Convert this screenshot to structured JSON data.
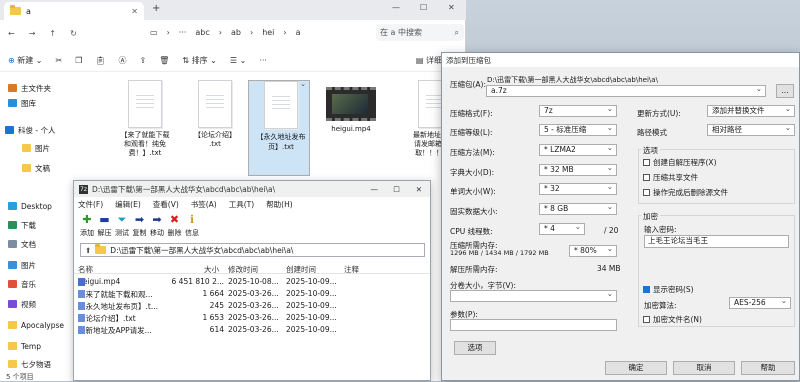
{
  "explorer": {
    "tab_title": "a",
    "address": [
      "abc",
      "ab",
      "hei",
      "a"
    ],
    "search_placeholder": "在 a 中搜索",
    "toolbar": {
      "new_label": "新建",
      "sort_label": "排序",
      "details_label": "详细信息"
    },
    "sidebar": [
      {
        "label": "主文件夹",
        "icon": "home-icon"
      },
      {
        "label": "图库",
        "icon": "gallery-icon"
      },
      {
        "label": "科俊 - 个人",
        "icon": "cloud-icon"
      },
      {
        "label": "图片",
        "icon": "folder-icon"
      },
      {
        "label": "文稿",
        "icon": "folder-icon"
      },
      {
        "label": "Desktop",
        "icon": "desktop-icon"
      },
      {
        "label": "下载",
        "icon": "download-icon"
      },
      {
        "label": "文档",
        "icon": "document-icon"
      },
      {
        "label": "图片",
        "icon": "pictures-icon"
      },
      {
        "label": "音乐",
        "icon": "music-icon"
      },
      {
        "label": "视频",
        "icon": "video-icon"
      },
      {
        "label": "Apocalypse",
        "icon": "folder-icon"
      },
      {
        "label": "Temp",
        "icon": "folder-icon"
      },
      {
        "label": "七夕物语",
        "icon": "folder-icon"
      }
    ],
    "files": [
      {
        "name": "【来了就能下载和观看！纯免费！】.txt",
        "line1": "【来了就能下载",
        "line2": "和观看！纯免",
        "line3": "费！】.txt"
      },
      {
        "name": "【论坛介绍】.txt",
        "line1": "【论坛介绍】",
        "line2": ".txt",
        "line3": ""
      },
      {
        "name": "【永久地址发布页】.txt",
        "line1": "【永久地址发布",
        "line2": "页】.txt",
        "line3": ""
      },
      {
        "name": "heigui.mp4",
        "line1": "heigui.mp4",
        "line2": "",
        "line3": ""
      },
      {
        "name": "最新地址及APP请发邮箱自动获取！！！.txt",
        "line1": "最新地址及AP",
        "line2": "请发邮箱自动",
        "line3": "取！！！.txt"
      }
    ],
    "status": "5 个项目"
  },
  "filemanager": {
    "title": "D:\\迅雷下载\\第一部黑人大战华女\\abcd\\abc\\ab\\hei\\a\\",
    "menu": [
      "文件(F)",
      "编辑(E)",
      "查看(V)",
      "书签(A)",
      "工具(T)",
      "帮助(H)"
    ],
    "tools": [
      "添加",
      "解压",
      "测试",
      "复制",
      "移动",
      "删除",
      "信息"
    ],
    "path": "D:\\迅雷下载\\第一部黑人大战华女\\abcd\\abc\\ab\\hei\\a\\",
    "columns": [
      "名称",
      "大小",
      "修改时间",
      "创建时间",
      "注释"
    ],
    "rows": [
      {
        "name": "heigui.mp4",
        "size": "6 451 810 2...",
        "modified": "2025-10-08...",
        "created": "2025-10-09..."
      },
      {
        "name": "【来了就能下载和观...",
        "size": "1 664",
        "modified": "2025-03-26...",
        "created": "2025-10-09..."
      },
      {
        "name": "【永久地址发布页】.t...",
        "size": "245",
        "modified": "2025-03-26...",
        "created": "2025-10-09..."
      },
      {
        "name": "【论坛介绍】.txt",
        "size": "1 653",
        "modified": "2025-03-26...",
        "created": "2025-10-09..."
      },
      {
        "name": "最新地址及APP请发...",
        "size": "614",
        "modified": "2025-03-26...",
        "created": "2025-10-09..."
      }
    ]
  },
  "dialog": {
    "title": "添加到压缩包",
    "archive_label": "压缩包(A):",
    "archive_path": "D:\\迅雷下载\\第一部黑人大战华女\\abcd\\abc\\ab\\hei\\a\\",
    "archive_name": "a.7z",
    "browse_label": "...",
    "format_label": "压缩格式(F):",
    "format_value": "7z",
    "level_label": "压缩等级(L):",
    "level_value": "5 - 标准压缩",
    "method_label": "压缩方法(M):",
    "method_value": "* LZMA2",
    "dict_label": "字典大小(D):",
    "dict_value": "* 32 MB",
    "word_label": "单词大小(W):",
    "word_value": "* 32",
    "solid_label": "固实数据大小:",
    "solid_value": "* 8 GB",
    "cpu_label": "CPU 线程数:",
    "cpu_value": "* 4",
    "cpu_max": "/ 20",
    "mem_label": "压缩所需内存:",
    "mem_detail": "1296 MB / 1434 MB / 1792 MB",
    "mem_percent": "* 80%",
    "decomp_label": "解压所需内存:",
    "decomp_value": "34 MB",
    "split_label": "分卷大小，字节(V):",
    "params_label": "参数(P):",
    "options_button": "选项",
    "update_label": "更新方式(U):",
    "update_value": "添加并替换文件",
    "pathmode_label": "路径模式",
    "pathmode_value": "相对路径",
    "options_title": "选项",
    "opt_sfx": "创建自解压程序(X)",
    "opt_shared": "压缩共享文件",
    "opt_delete": "操作完成后删除源文件",
    "encrypt_title": "加密",
    "password_label": "输入密码:",
    "password_value": "上毛王论坛当毛王",
    "show_password": "显示密码(S)",
    "enc_method_label": "加密算法:",
    "enc_method_value": "AES-256",
    "enc_names": "加密文件名(N)",
    "ok": "确定",
    "cancel": "取消",
    "help": "帮助"
  }
}
